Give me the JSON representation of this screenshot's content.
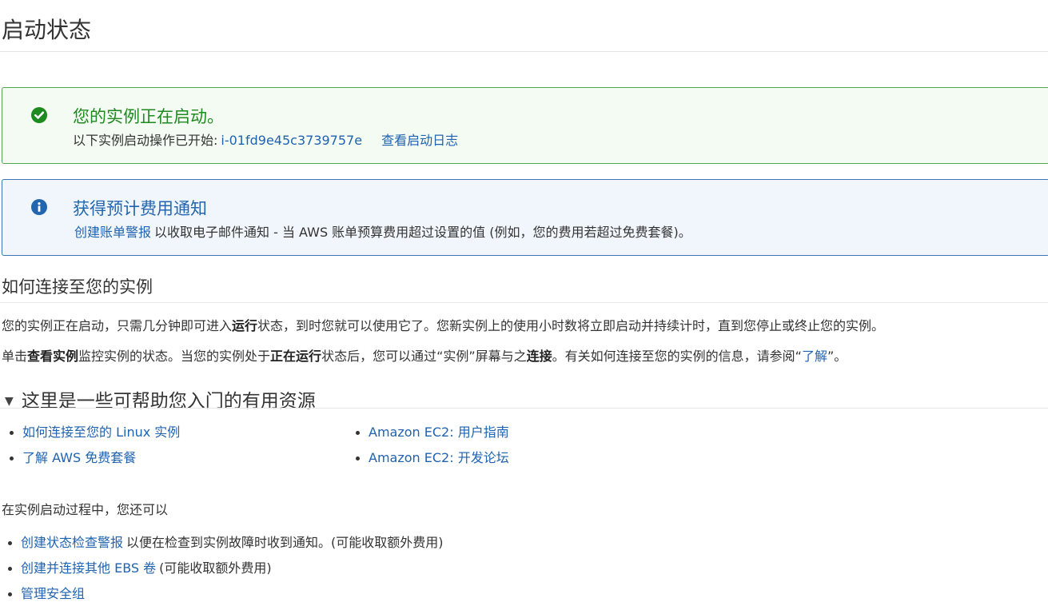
{
  "page": {
    "title": "启动状态"
  },
  "success_alert": {
    "icon": "check-circle-icon",
    "color": "#1f8a1f",
    "title": "您的实例正在启动。",
    "text": "以下实例启动操作已开始:",
    "instance_id": "i-01fd9e45c3739757e",
    "log_link": "查看启动日志"
  },
  "info_alert": {
    "icon": "info-circle-icon",
    "color": "#2366b0",
    "title": "获得预计费用通知",
    "link": "创建账单警报",
    "text": "以收取电子邮件通知 - 当 AWS 账单预算费用超过设置的值 (例如，您的费用若超过免费套餐)。"
  },
  "connect_section": {
    "title": "如何连接至您的实例",
    "p1": {
      "a": "您的实例正在启动，只需几分钟即可进入",
      "b_running": "运行",
      "c": "状态，到时您就可以使用它了。您新实例上的使用小时数将立即启动并持续计时，直到您停止或终止您的实例。"
    },
    "p2": {
      "a": "单击",
      "b_view": "查看实例",
      "c": "监控实例的状态。当您的实例处于",
      "d_running": "正在运行",
      "e": "状态后，您可以通过“实例”屏幕与之",
      "f_connect": "连接",
      "g": "。有关如何连接至您的实例的信息，请参阅“",
      "h_link": "了解",
      "i": "”。"
    }
  },
  "resources": {
    "title": "这里是一些可帮助您入门的有用资源",
    "left": [
      "如何连接至您的 Linux 实例",
      "了解 AWS 免费套餐"
    ],
    "right": [
      "Amazon EC2: 用户指南",
      "Amazon EC2: 开发论坛"
    ]
  },
  "launch_extras": {
    "intro": "在实例启动过程中，您还可以",
    "items": [
      {
        "link": "创建状态检查警报",
        "text": "以便在检查到实例故障时收到通知。(可能收取额外费用)"
      },
      {
        "link": "创建并连接其他 EBS 卷",
        "text": "(可能收取额外费用)"
      },
      {
        "link": "管理安全组",
        "text": ""
      }
    ]
  }
}
